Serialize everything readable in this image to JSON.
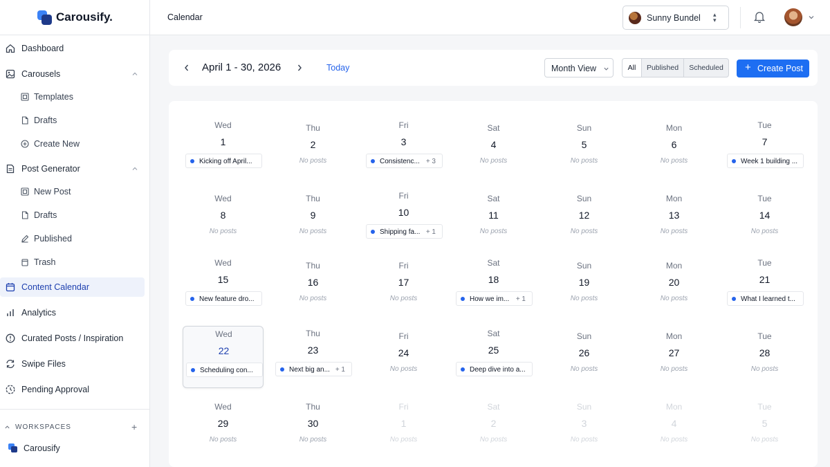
{
  "app": {
    "name": "Carousify."
  },
  "sidebar": {
    "items": [
      {
        "label": "Dashboard",
        "icon": "home-icon"
      },
      {
        "label": "Carousels",
        "icon": "image-icon"
      },
      {
        "label": "Templates",
        "icon": "template-icon"
      },
      {
        "label": "Drafts",
        "icon": "file-icon"
      },
      {
        "label": "Create New",
        "icon": "plus-circle-icon"
      },
      {
        "label": "Post Generator",
        "icon": "document-icon"
      },
      {
        "label": "New Post",
        "icon": "template-icon"
      },
      {
        "label": "Drafts",
        "icon": "file-icon"
      },
      {
        "label": "Published",
        "icon": "pencil-icon"
      },
      {
        "label": "Trash",
        "icon": "trash-icon"
      },
      {
        "label": "Content Calendar",
        "icon": "calendar-icon"
      },
      {
        "label": "Analytics",
        "icon": "bar-chart-icon"
      },
      {
        "label": "Curated Posts / Inspiration",
        "icon": "compass-icon"
      },
      {
        "label": "Swipe Files",
        "icon": "refresh-icon"
      },
      {
        "label": "Pending Approval",
        "icon": "clock-dashed-icon"
      }
    ],
    "workspaces_label": "WORKSPACES",
    "workspace": "Carousify"
  },
  "topbar": {
    "title": "Calendar",
    "user_name": "Sunny Bundel"
  },
  "toolbar": {
    "range": "April 1 - 30, 2026",
    "today": "Today",
    "view": "Month View",
    "filters": [
      "All",
      "Published",
      "Scheduled"
    ],
    "active_filter": "All",
    "create": "Create Post"
  },
  "calendar": {
    "days": [
      {
        "dow": "Wed",
        "num": "1",
        "post": "Kicking off April..."
      },
      {
        "dow": "Thu",
        "num": "2",
        "empty": "No posts"
      },
      {
        "dow": "Fri",
        "num": "3",
        "post": "Consistenc...",
        "more": "+ 3"
      },
      {
        "dow": "Sat",
        "num": "4",
        "empty": "No posts"
      },
      {
        "dow": "Sun",
        "num": "5",
        "empty": "No posts"
      },
      {
        "dow": "Mon",
        "num": "6",
        "empty": "No posts"
      },
      {
        "dow": "Tue",
        "num": "7",
        "post": "Week 1 building ..."
      },
      {
        "dow": "Wed",
        "num": "8",
        "empty": "No posts"
      },
      {
        "dow": "Thu",
        "num": "9",
        "empty": "No posts"
      },
      {
        "dow": "Fri",
        "num": "10",
        "post": "Shipping fa...",
        "more": "+ 1"
      },
      {
        "dow": "Sat",
        "num": "11",
        "empty": "No posts"
      },
      {
        "dow": "Sun",
        "num": "12",
        "empty": "No posts"
      },
      {
        "dow": "Mon",
        "num": "13",
        "empty": "No posts"
      },
      {
        "dow": "Tue",
        "num": "14",
        "empty": "No posts"
      },
      {
        "dow": "Wed",
        "num": "15",
        "post": "New feature dro..."
      },
      {
        "dow": "Thu",
        "num": "16",
        "empty": "No posts"
      },
      {
        "dow": "Fri",
        "num": "17",
        "empty": "No posts"
      },
      {
        "dow": "Sat",
        "num": "18",
        "post": "How we im...",
        "more": "+ 1"
      },
      {
        "dow": "Sun",
        "num": "19",
        "empty": "No posts"
      },
      {
        "dow": "Mon",
        "num": "20",
        "empty": "No posts"
      },
      {
        "dow": "Tue",
        "num": "21",
        "post": "What I learned t..."
      },
      {
        "dow": "Wed",
        "num": "22",
        "post": "Scheduling con..."
      },
      {
        "dow": "Thu",
        "num": "23",
        "post": "Next big an...",
        "more": "+ 1"
      },
      {
        "dow": "Fri",
        "num": "24",
        "empty": "No posts"
      },
      {
        "dow": "Sat",
        "num": "25",
        "post": "Deep dive into a..."
      },
      {
        "dow": "Sun",
        "num": "26",
        "empty": "No posts"
      },
      {
        "dow": "Mon",
        "num": "27",
        "empty": "No posts"
      },
      {
        "dow": "Tue",
        "num": "28",
        "empty": "No posts"
      },
      {
        "dow": "Wed",
        "num": "29",
        "empty": "No posts"
      },
      {
        "dow": "Thu",
        "num": "30",
        "empty": "No posts"
      },
      {
        "dow": "Fri",
        "num": "1",
        "empty": "No posts"
      },
      {
        "dow": "Sat",
        "num": "2",
        "empty": "No posts"
      },
      {
        "dow": "Sun",
        "num": "3",
        "empty": "No posts"
      },
      {
        "dow": "Mon",
        "num": "4",
        "empty": "No posts"
      },
      {
        "dow": "Tue",
        "num": "5",
        "empty": "No posts"
      }
    ]
  },
  "colors": {
    "accent": "#1d6ef2",
    "active_nav": "#1e40af",
    "post_dot": "#2563eb"
  }
}
